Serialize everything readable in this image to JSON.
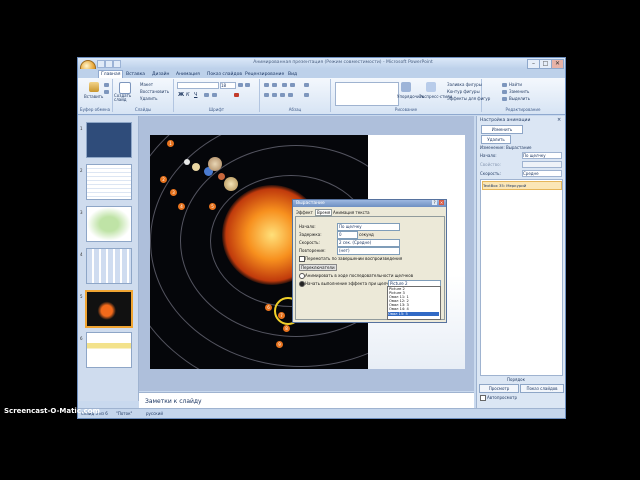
{
  "window": {
    "title": "Анимированная презентация (Режим совместимости) - Microsoft PowerPoint",
    "buttons": {
      "minimize": "–",
      "maximize": "□",
      "close": "✕"
    }
  },
  "tabs": [
    "Главная",
    "Вставка",
    "Дизайн",
    "Анимация",
    "Показ слайдов",
    "Рецензирование",
    "Вид"
  ],
  "ribbon": {
    "clipboard": {
      "label": "Буфер обмена",
      "paste": "Вставить"
    },
    "slides": {
      "label": "Слайды",
      "new_slide": "Создать слайд",
      "layout": "Макет",
      "reset": "Восстановить",
      "delete": "Удалить"
    },
    "font": {
      "label": "Шрифт",
      "size": "18"
    },
    "paragraph": {
      "label": "Абзац"
    },
    "drawing": {
      "label": "Рисование",
      "arrange": "Упорядочить",
      "quick_styles": "Экспресс-стили",
      "fill": "Заливка фигуры",
      "outline": "Контур фигуры",
      "effects": "Эффекты для фигур"
    },
    "editing": {
      "label": "Редактирование",
      "find": "Найти",
      "replace": "Заменить",
      "select": "Выделить"
    }
  },
  "notes": {
    "placeholder": "Заметки к слайду"
  },
  "status": {
    "slide": "Слайд 5 из 6",
    "theme": "\"Поток\"",
    "language": "русский"
  },
  "taskpane": {
    "title": "Настройка анимации",
    "change_button": "Изменить",
    "delete_button": "Удалить",
    "effect_heading": "Изменение: Вырастание",
    "start_label": "Начало:",
    "start_value": "По щелчку",
    "property_label": "Свойство:",
    "speed_label": "Скорость:",
    "speed_value": "Средне",
    "list_item": "TextBox 35: Меркурий",
    "reorder_label": "Порядок",
    "preview_button": "Просмотр",
    "slideshow_button": "Показ слайдов",
    "autopreview": "Автопросмотр"
  },
  "dialog": {
    "title": "Вырастание",
    "tabs": [
      "Эффект",
      "Время",
      "Анимация текста"
    ],
    "start_label": "Начало:",
    "start_value": "По щелчку",
    "delay_label": "Задержка:",
    "delay_value": "0",
    "delay_unit": "секунд",
    "speed_label": "Скорость:",
    "speed_value": "2 сек. (Средне)",
    "repeat_label": "Повторение:",
    "repeat_value": "(нет)",
    "rewind_label": "Перемотать по завершении воспроизведения",
    "triggers_button": "Переключатели",
    "animate_sequence": "Анимировать в ходе последовательности щелчков",
    "start_effect": "Начать выполнение эффекта при щелчке",
    "trigger_value": "Picture 2",
    "options": [
      "Picture 2",
      "Picture 3",
      "Овал 11: 1",
      "Овал 12: 2",
      "Овал 13: 3",
      "Овал 14: 4",
      "Овал 15: 5"
    ]
  },
  "watermark": "Screencast-O-Matic.com"
}
